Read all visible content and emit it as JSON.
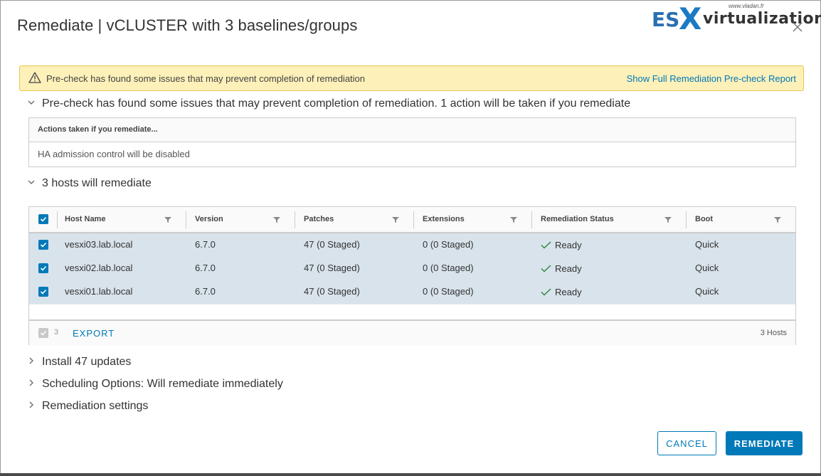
{
  "dialog": {
    "title": "Remediate | vCLUSTER with 3 baselines/groups",
    "close_icon": "close-icon"
  },
  "logo": {
    "url": "www.vladan.fr",
    "es": "ES",
    "x": "X",
    "virt": "virtualization"
  },
  "alert": {
    "icon": "warning-icon",
    "message": "Pre-check has found some issues that may prevent completion of remediation",
    "link": "Show Full Remediation Pre-check Report"
  },
  "precheck_section": {
    "label": "Pre-check has found some issues that may prevent completion of remediation. 1 action will be taken if you remediate",
    "actions_header": "Actions taken if you remediate...",
    "actions": [
      "HA admission control will be disabled"
    ]
  },
  "hosts_section": {
    "label": "3 hosts will remediate",
    "columns": [
      "Host Name",
      "Version",
      "Patches",
      "Extensions",
      "Remediation Status",
      "Boot"
    ],
    "rows": [
      {
        "host": "vesxi03.lab.local",
        "version": "6.7.0",
        "patches": "47 (0 Staged)",
        "extensions": "0 (0 Staged)",
        "status": "Ready",
        "boot": "Quick",
        "checked": true
      },
      {
        "host": "vesxi02.lab.local",
        "version": "6.7.0",
        "patches": "47 (0 Staged)",
        "extensions": "0 (0 Staged)",
        "status": "Ready",
        "boot": "Quick",
        "checked": true
      },
      {
        "host": "vesxi01.lab.local",
        "version": "6.7.0",
        "patches": "47 (0 Staged)",
        "extensions": "0 (0 Staged)",
        "status": "Ready",
        "boot": "Quick",
        "checked": true
      }
    ],
    "footer": {
      "selected_count": "3",
      "export_label": "EXPORT",
      "total_label": "3 Hosts"
    }
  },
  "collapsed_sections": [
    "Install 47 updates",
    "Scheduling Options: Will remediate immediately",
    "Remediation settings"
  ],
  "buttons": {
    "cancel": "CANCEL",
    "remediate": "REMEDIATE"
  },
  "colors": {
    "accent": "#0079b8",
    "alert_bg": "#fdf0b9",
    "selected_row": "#d8e3eb",
    "ready_check": "#2e8540"
  }
}
